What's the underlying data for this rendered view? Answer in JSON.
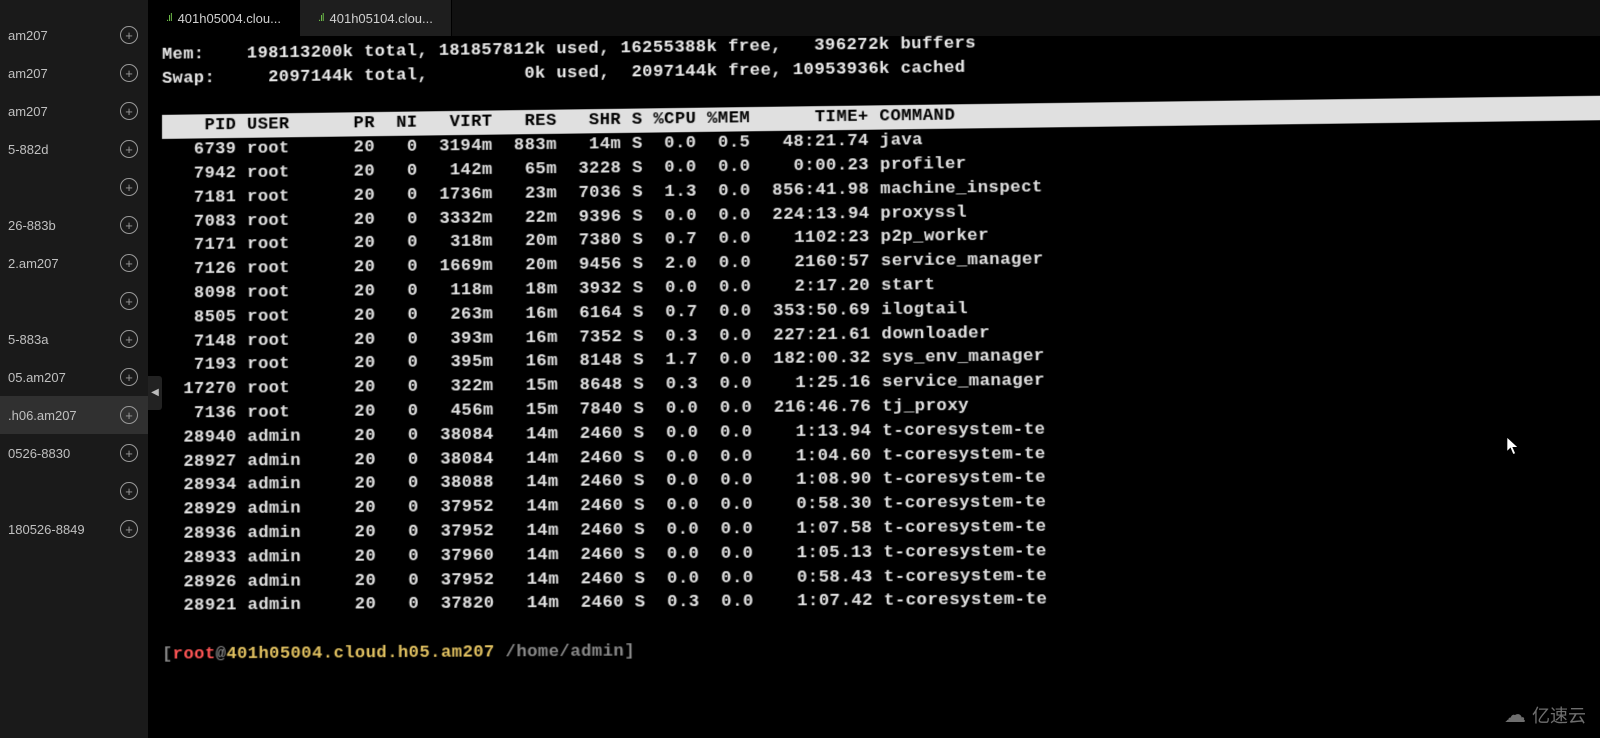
{
  "sidebar": {
    "items": [
      {
        "label": "am207"
      },
      {
        "label": "am207"
      },
      {
        "label": "am207"
      },
      {
        "label": "5-882d"
      },
      {
        "label": ""
      },
      {
        "label": "26-883b"
      },
      {
        "label": "2.am207"
      },
      {
        "label": ""
      },
      {
        "label": "5-883a"
      },
      {
        "label": "05.am207"
      },
      {
        "label": ".h06.am207",
        "active": true
      },
      {
        "label": "0526-8830"
      },
      {
        "label": ""
      },
      {
        "label": "180526-8849"
      }
    ]
  },
  "tabs": [
    {
      "label": "401h05004.clou...",
      "active": true
    },
    {
      "label": "401h05104.clou..."
    }
  ],
  "mem": {
    "label": "Mem:",
    "total": "198113200k total,",
    "used": "181857812k used,",
    "free": "16255388k free,",
    "buffers": "396272k buffers"
  },
  "swap": {
    "label": "Swap:",
    "total": "2097144k total,",
    "used": "0k used,",
    "free": "2097144k free,",
    "cached": "10953936k cached"
  },
  "columns": {
    "pid": "PID",
    "user": "USER",
    "pr": "PR",
    "ni": "NI",
    "virt": "VIRT",
    "res": "RES",
    "shr": "SHR",
    "s": "S",
    "cpu": "%CPU",
    "mem": "%MEM",
    "time": "TIME+",
    "cmd": "COMMAND"
  },
  "processes": [
    {
      "pid": "6739",
      "user": "root",
      "pr": "20",
      "ni": "0",
      "virt": "3194m",
      "res": "883m",
      "shr": "14m",
      "s": "S",
      "cpu": "0.0",
      "mem": "0.5",
      "time": "48:21.74",
      "cmd": "java"
    },
    {
      "pid": "7942",
      "user": "root",
      "pr": "20",
      "ni": "0",
      "virt": "142m",
      "res": "65m",
      "shr": "3228",
      "s": "S",
      "cpu": "0.0",
      "mem": "0.0",
      "time": "0:00.23",
      "cmd": "profiler"
    },
    {
      "pid": "7181",
      "user": "root",
      "pr": "20",
      "ni": "0",
      "virt": "1736m",
      "res": "23m",
      "shr": "7036",
      "s": "S",
      "cpu": "1.3",
      "mem": "0.0",
      "time": "856:41.98",
      "cmd": "machine_inspect"
    },
    {
      "pid": "7083",
      "user": "root",
      "pr": "20",
      "ni": "0",
      "virt": "3332m",
      "res": "22m",
      "shr": "9396",
      "s": "S",
      "cpu": "0.0",
      "mem": "0.0",
      "time": "224:13.94",
      "cmd": "proxyssl"
    },
    {
      "pid": "7171",
      "user": "root",
      "pr": "20",
      "ni": "0",
      "virt": "318m",
      "res": "20m",
      "shr": "7380",
      "s": "S",
      "cpu": "0.7",
      "mem": "0.0",
      "time": "1102:23",
      "cmd": "p2p_worker"
    },
    {
      "pid": "7126",
      "user": "root",
      "pr": "20",
      "ni": "0",
      "virt": "1669m",
      "res": "20m",
      "shr": "9456",
      "s": "S",
      "cpu": "2.0",
      "mem": "0.0",
      "time": "2160:57",
      "cmd": "service_manager"
    },
    {
      "pid": "8098",
      "user": "root",
      "pr": "20",
      "ni": "0",
      "virt": "118m",
      "res": "18m",
      "shr": "3932",
      "s": "S",
      "cpu": "0.0",
      "mem": "0.0",
      "time": "2:17.20",
      "cmd": "start"
    },
    {
      "pid": "8505",
      "user": "root",
      "pr": "20",
      "ni": "0",
      "virt": "263m",
      "res": "16m",
      "shr": "6164",
      "s": "S",
      "cpu": "0.7",
      "mem": "0.0",
      "time": "353:50.69",
      "cmd": "ilogtail"
    },
    {
      "pid": "7148",
      "user": "root",
      "pr": "20",
      "ni": "0",
      "virt": "393m",
      "res": "16m",
      "shr": "7352",
      "s": "S",
      "cpu": "0.3",
      "mem": "0.0",
      "time": "227:21.61",
      "cmd": "downloader"
    },
    {
      "pid": "7193",
      "user": "root",
      "pr": "20",
      "ni": "0",
      "virt": "395m",
      "res": "16m",
      "shr": "8148",
      "s": "S",
      "cpu": "1.7",
      "mem": "0.0",
      "time": "182:00.32",
      "cmd": "sys_env_manager"
    },
    {
      "pid": "17270",
      "user": "root",
      "pr": "20",
      "ni": "0",
      "virt": "322m",
      "res": "15m",
      "shr": "8648",
      "s": "S",
      "cpu": "0.3",
      "mem": "0.0",
      "time": "1:25.16",
      "cmd": "service_manager"
    },
    {
      "pid": "7136",
      "user": "root",
      "pr": "20",
      "ni": "0",
      "virt": "456m",
      "res": "15m",
      "shr": "7840",
      "s": "S",
      "cpu": "0.0",
      "mem": "0.0",
      "time": "216:46.76",
      "cmd": "tj_proxy"
    },
    {
      "pid": "28940",
      "user": "admin",
      "pr": "20",
      "ni": "0",
      "virt": "38084",
      "res": "14m",
      "shr": "2460",
      "s": "S",
      "cpu": "0.0",
      "mem": "0.0",
      "time": "1:13.94",
      "cmd": "t-coresystem-te"
    },
    {
      "pid": "28927",
      "user": "admin",
      "pr": "20",
      "ni": "0",
      "virt": "38084",
      "res": "14m",
      "shr": "2460",
      "s": "S",
      "cpu": "0.0",
      "mem": "0.0",
      "time": "1:04.60",
      "cmd": "t-coresystem-te"
    },
    {
      "pid": "28934",
      "user": "admin",
      "pr": "20",
      "ni": "0",
      "virt": "38088",
      "res": "14m",
      "shr": "2460",
      "s": "S",
      "cpu": "0.0",
      "mem": "0.0",
      "time": "1:08.90",
      "cmd": "t-coresystem-te"
    },
    {
      "pid": "28929",
      "user": "admin",
      "pr": "20",
      "ni": "0",
      "virt": "37952",
      "res": "14m",
      "shr": "2460",
      "s": "S",
      "cpu": "0.0",
      "mem": "0.0",
      "time": "0:58.30",
      "cmd": "t-coresystem-te"
    },
    {
      "pid": "28936",
      "user": "admin",
      "pr": "20",
      "ni": "0",
      "virt": "37952",
      "res": "14m",
      "shr": "2460",
      "s": "S",
      "cpu": "0.0",
      "mem": "0.0",
      "time": "1:07.58",
      "cmd": "t-coresystem-te"
    },
    {
      "pid": "28933",
      "user": "admin",
      "pr": "20",
      "ni": "0",
      "virt": "37960",
      "res": "14m",
      "shr": "2460",
      "s": "S",
      "cpu": "0.0",
      "mem": "0.0",
      "time": "1:05.13",
      "cmd": "t-coresystem-te"
    },
    {
      "pid": "28926",
      "user": "admin",
      "pr": "20",
      "ni": "0",
      "virt": "37952",
      "res": "14m",
      "shr": "2460",
      "s": "S",
      "cpu": "0.0",
      "mem": "0.0",
      "time": "0:58.43",
      "cmd": "t-coresystem-te"
    },
    {
      "pid": "28921",
      "user": "admin",
      "pr": "20",
      "ni": "0",
      "virt": "37820",
      "res": "14m",
      "shr": "2460",
      "s": "S",
      "cpu": "0.3",
      "mem": "0.0",
      "time": "1:07.42",
      "cmd": "t-coresystem-te"
    }
  ],
  "prompt": {
    "open": "[",
    "user": "root",
    "at": "@",
    "host": "401h05004.cloud.h05.am207",
    "path": " /home/admin]",
    "close": ""
  },
  "watermark": "亿速云"
}
